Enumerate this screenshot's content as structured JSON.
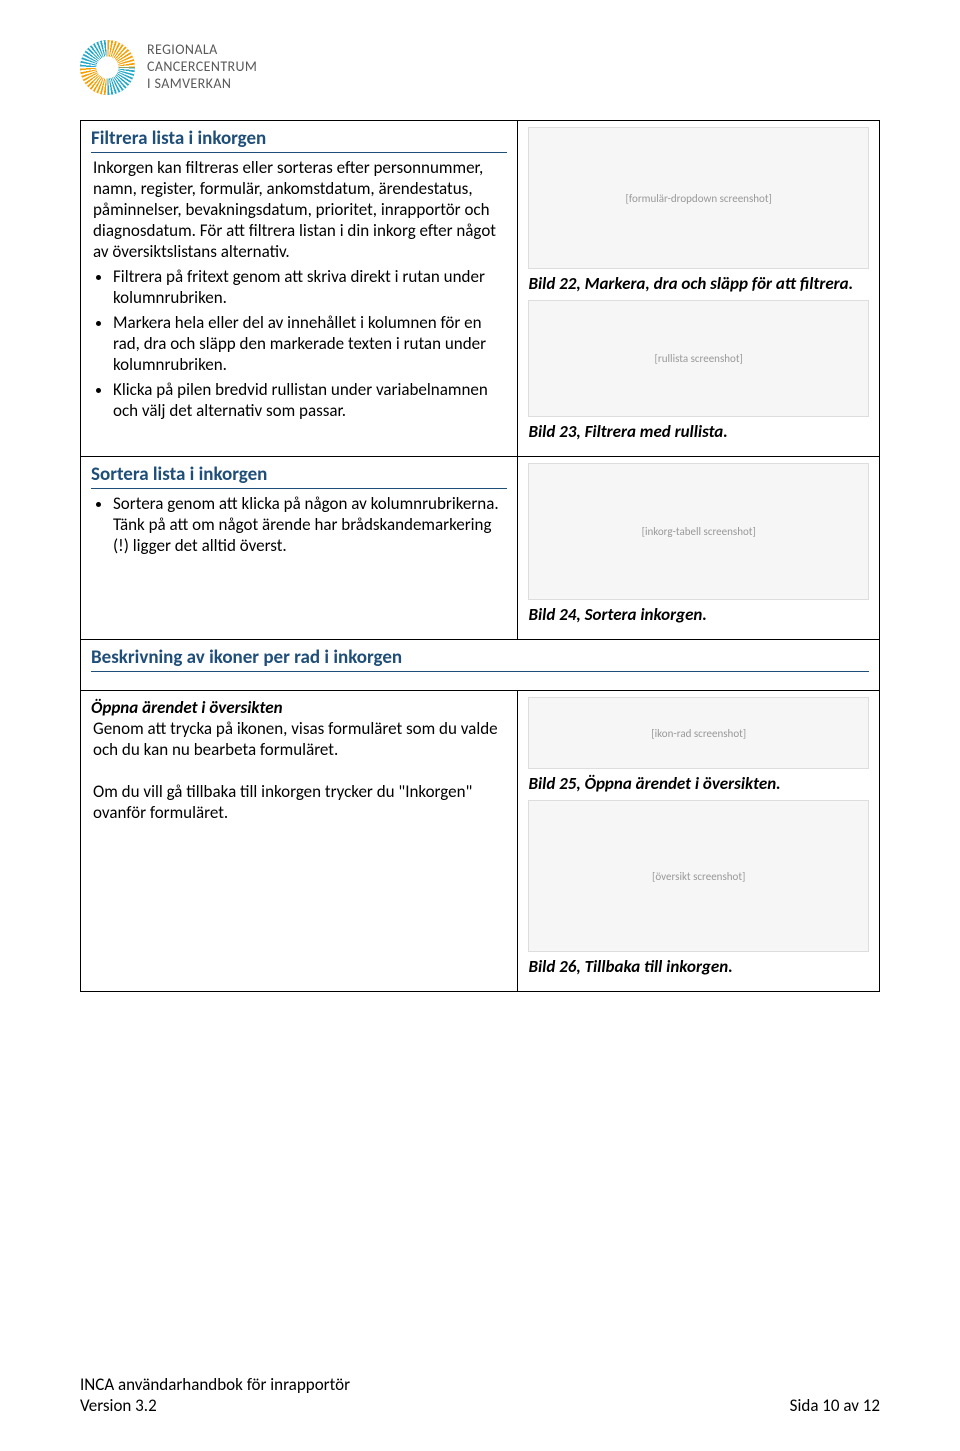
{
  "header": {
    "logo_line1": "REGIONALA",
    "logo_line2": "CANCERCENTRUM",
    "logo_line3": "I SAMVERKAN"
  },
  "cell1": {
    "title": "Filtrera lista i inkorgen",
    "p1": "Inkorgen kan filtreras eller sorteras efter personnummer, namn, register, formulär, ankomstdatum, ärendestatus, påminnelser, bevakningsdatum, prioritet, inrapportör och diagnosdatum. För att filtrera listan i din inkorg efter något av översiktslistans alternativ.",
    "b1": "Filtrera på fritext genom att skriva direkt i rutan under kolumnrubriken.",
    "b2": "Markera hela eller del av innehållet i kolumnen för en rad, dra och släpp den markerade texten i rutan under kolumnrubriken.",
    "b3": "Klicka på pilen bredvid rullistan under variabelnamnen och välj det alternativ som passar."
  },
  "cell1r": {
    "img_placeholder1": "[formulär-dropdown screenshot]",
    "cap1": "Bild 22, Markera, dra och släpp för att filtrera.",
    "img_placeholder2": "[rullista screenshot]",
    "cap2": "Bild 23, Filtrera med rullista."
  },
  "cell2": {
    "title": "Sortera lista i inkorgen",
    "b1": "Sortera genom att klicka på någon av kolumnrubrikerna. Tänk på att om något ärende har brådskandemarkering (!) ligger det alltid överst."
  },
  "cell2r": {
    "img_placeholder": "[inkorg-tabell screenshot]",
    "cap": "Bild 24, Sortera inkorgen."
  },
  "cell3": {
    "title": "Beskrivning av ikoner per rad i inkorgen"
  },
  "cell4": {
    "sub": "Öppna ärendet i översikten",
    "p1": "Genom att trycka på ikonen, visas formuläret som du valde och du kan nu bearbeta formuläret.",
    "p2": "Om du vill gå tillbaka till inkorgen trycker du \"Inkorgen\" ovanför formuläret."
  },
  "cell4r": {
    "img_placeholder1": "[ikon-rad screenshot]",
    "cap1": "Bild 25, Öppna ärendet i översikten.",
    "img_placeholder2": "[översikt screenshot]",
    "cap2": "Bild 26, Tillbaka till inkorgen."
  },
  "footer": {
    "left1": "INCA användarhandbok för inrapportör",
    "left2": "Version 3.2",
    "right": "Sida 10 av 12"
  }
}
